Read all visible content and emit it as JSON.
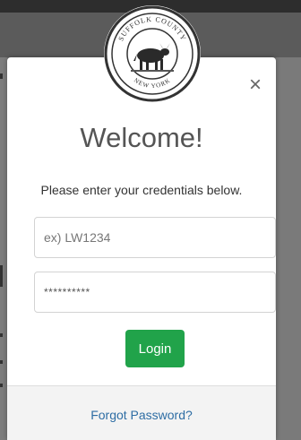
{
  "seal": {
    "icon": "county-seal-emblem-icon",
    "top_text": "SUFFOLK COUNTY",
    "bottom_text": "NEW YORK"
  },
  "login_modal": {
    "title": "Welcome!",
    "subtitle": "Please enter your credentials below.",
    "close_glyph": "×",
    "username_placeholder": "ex) LW1234",
    "password_value": "**********",
    "login_label": "Login",
    "forgot_password_label": "Forgot Password?"
  },
  "colors": {
    "login_button": "#21a34a",
    "link": "#2e6da4",
    "title": "#555555"
  }
}
